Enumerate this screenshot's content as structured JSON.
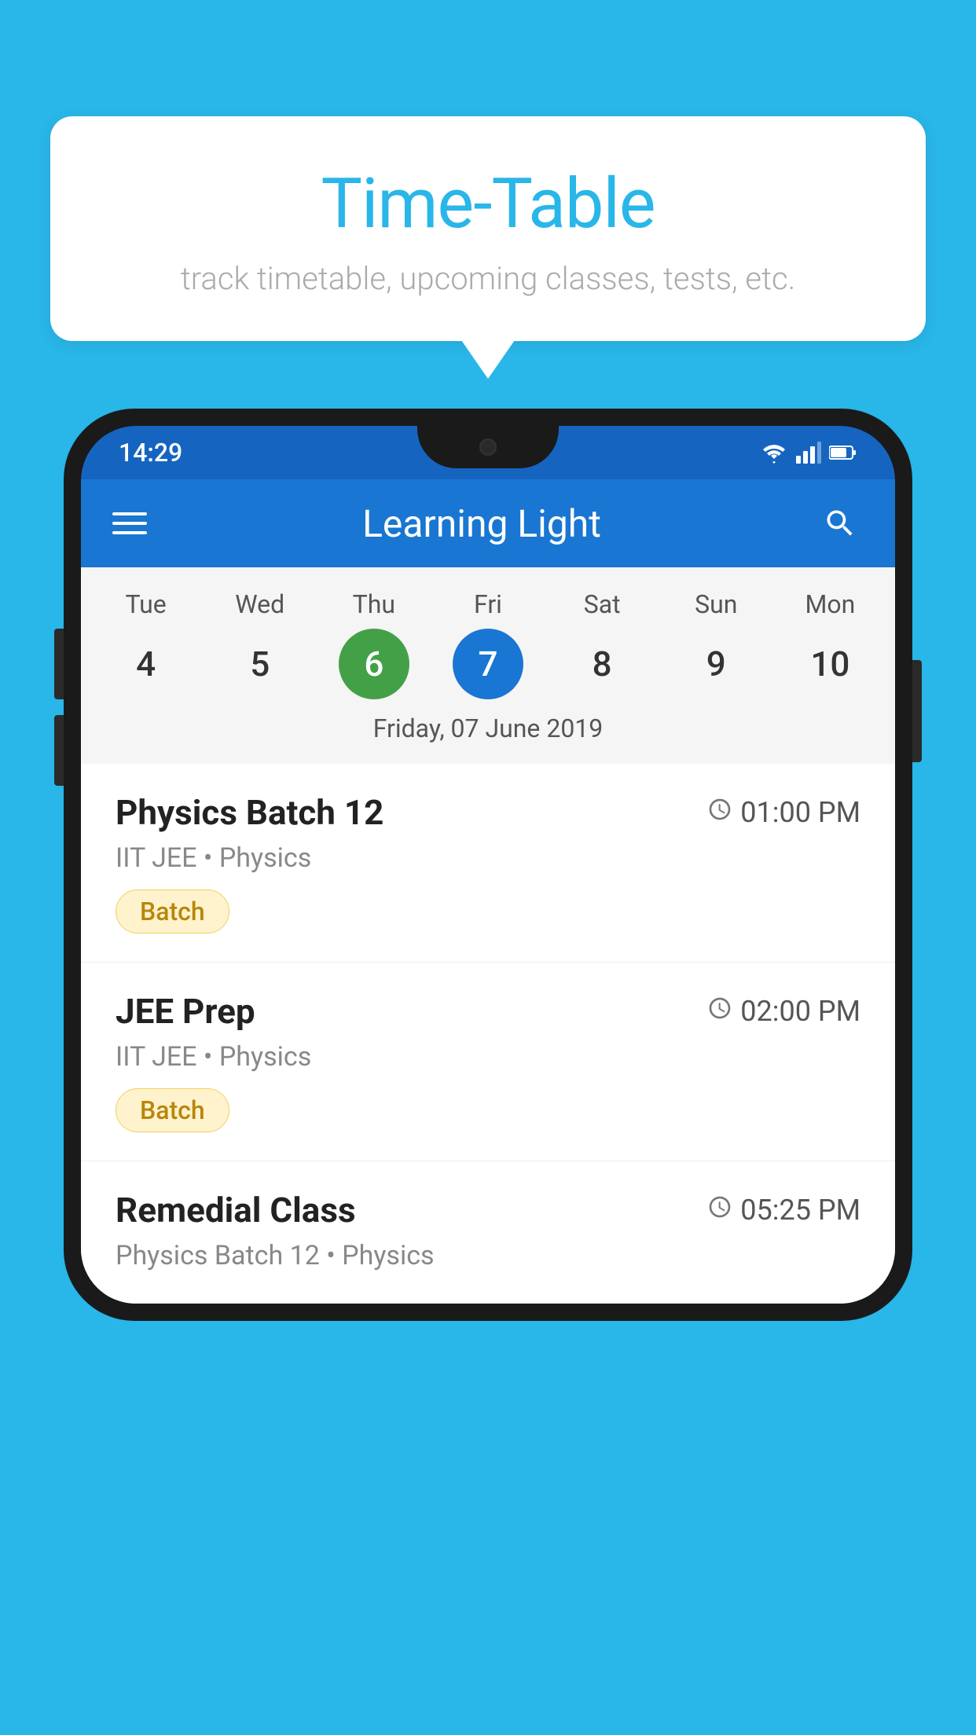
{
  "background_color": "#29b6e8",
  "speech_bubble": {
    "title": "Time-Table",
    "subtitle": "track timetable, upcoming classes, tests, etc."
  },
  "phone": {
    "status_bar": {
      "time": "14:29",
      "wifi_icon": "wifi",
      "signal_icon": "signal",
      "battery_icon": "battery"
    },
    "app_bar": {
      "title": "Learning Light",
      "menu_icon": "hamburger",
      "search_icon": "search"
    },
    "calendar": {
      "days": [
        "Tue",
        "Wed",
        "Thu",
        "Fri",
        "Sat",
        "Sun",
        "Mon"
      ],
      "numbers": [
        "4",
        "5",
        "6",
        "7",
        "8",
        "9",
        "10"
      ],
      "today_index": 2,
      "selected_index": 3,
      "date_label": "Friday, 07 June 2019"
    },
    "classes": [
      {
        "name": "Physics Batch 12",
        "time": "01:00 PM",
        "subtitle": "IIT JEE • Physics",
        "badge": "Batch"
      },
      {
        "name": "JEE Prep",
        "time": "02:00 PM",
        "subtitle": "IIT JEE • Physics",
        "badge": "Batch"
      },
      {
        "name": "Remedial Class",
        "time": "05:25 PM",
        "subtitle": "Physics Batch 12 • Physics",
        "badge": ""
      }
    ]
  }
}
